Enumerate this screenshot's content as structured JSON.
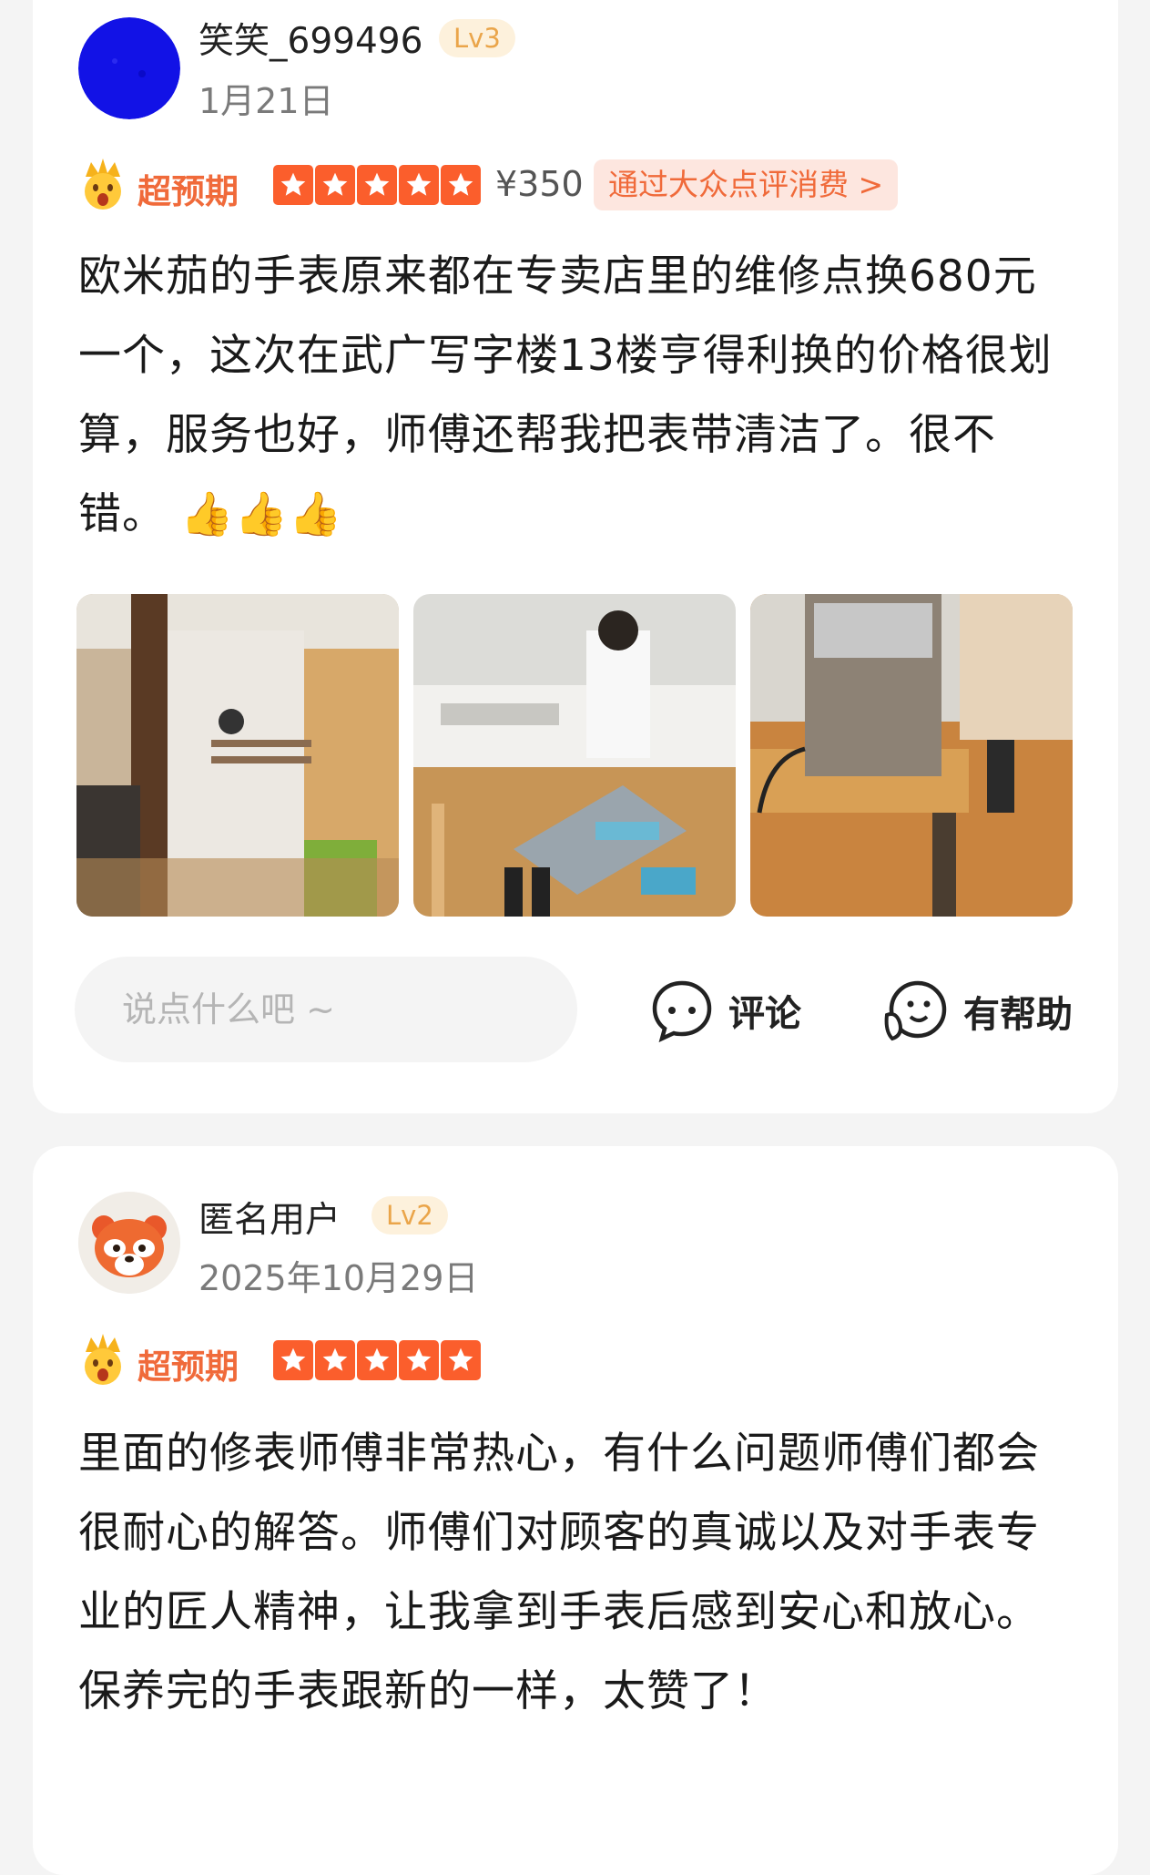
{
  "reviews": [
    {
      "user": {
        "name": "笑笑_699496",
        "level": "Lv3",
        "date": "1月21日",
        "avatar": "blue-circle-avatar"
      },
      "badge": "超预期",
      "rating": 5,
      "price": "¥350",
      "source_link": "通过大众点评消费 >",
      "text": "欧米茄的手表原来都在专卖店里的维修点换680元一个，这次在武广写字楼13楼亨得利换的价格很划算，服务也好，师傅还帮我把表带清洁了。很不错。",
      "emojis": "👍👍👍",
      "photos": [
        "store-entrance-photo",
        "watch-repair-workbench-photo",
        "ultrasonic-cleaner-photo"
      ],
      "comment_placeholder": "说点什么吧 ~",
      "actions": {
        "comment": "评论",
        "helpful": "有帮助"
      }
    },
    {
      "user": {
        "name": "匿名用户",
        "level": "Lv2",
        "date": "2025年10月29日",
        "avatar": "red-panda-avatar"
      },
      "badge": "超预期",
      "rating": 5,
      "text": "里面的修表师傅非常热心，有什么问题师傅们都会很耐心的解答。师傅们对顾客的真诚以及对手表专业的匠人精神，让我拿到手表后感到安心和放心。保养完的手表跟新的一样，太赞了！"
    }
  ],
  "colors": {
    "accent": "#fb5e2c",
    "badge_text": "#f06a3a",
    "level_text": "#eaa54a",
    "page_bg": "#f4f4f4"
  }
}
